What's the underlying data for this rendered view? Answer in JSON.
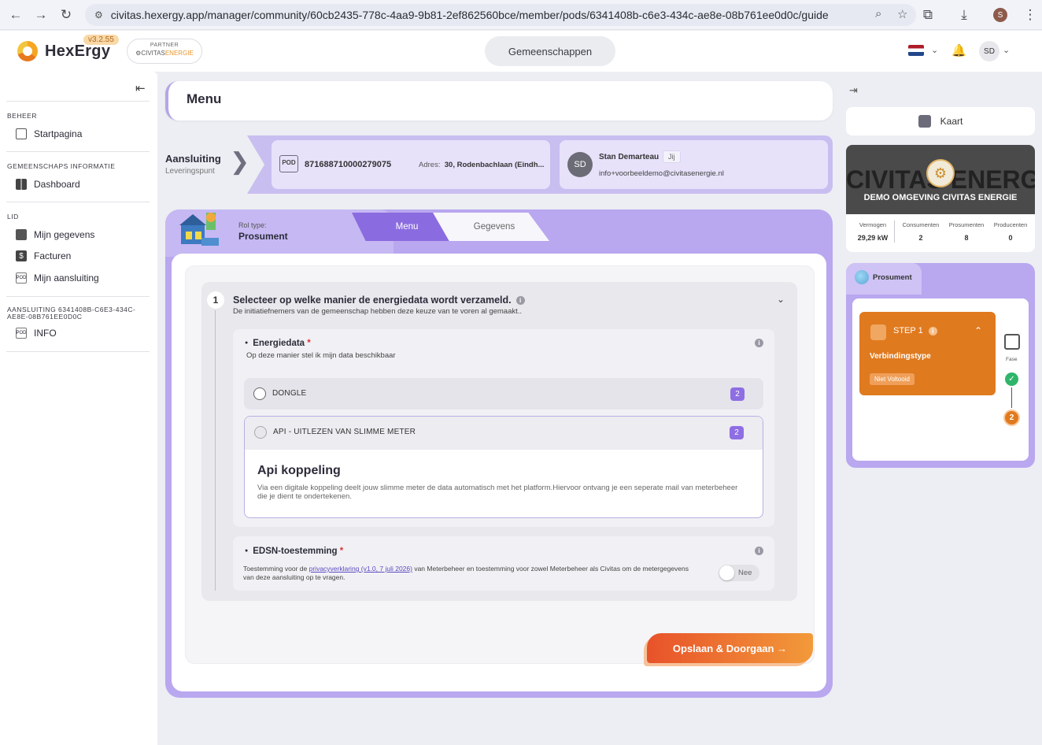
{
  "browser": {
    "url": "civitas.hexergy.app/manager/community/60cb2435-778c-4aa9-9b81-2ef862560bce/member/pods/6341408b-c6e3-434c-ae8e-08b761ee0d0c/guide",
    "profile_initial": "S"
  },
  "header": {
    "brand": "HexErgy",
    "version": "v3.2.55",
    "partner_label": "PARTNER",
    "partner_name_a": "CIVITAS",
    "partner_name_b": "ENERGIE",
    "center_button": "Gemeenschappen",
    "user_initials": "SD",
    "accent_color": "#f29a3a"
  },
  "sidebar": {
    "sections": [
      {
        "title": "BEHEER",
        "items": [
          {
            "label": "Startpagina",
            "icon": "home-icon"
          }
        ]
      },
      {
        "title": "GEMEENSCHAPS INFORMATIE",
        "items": [
          {
            "label": "Dashboard",
            "icon": "dashboard-icon"
          }
        ]
      },
      {
        "title": "LID",
        "items": [
          {
            "label": "Mijn gegevens",
            "icon": "profile-icon"
          },
          {
            "label": "Facturen",
            "icon": "invoice-icon"
          },
          {
            "label": "Mijn aansluiting",
            "icon": "pod-icon"
          }
        ]
      },
      {
        "title": "AANSLUITING 6341408B-C6E3-434C-AE8E-08B761EE0D0C",
        "items": [
          {
            "label": "INFO",
            "icon": "pod-icon"
          }
        ]
      }
    ]
  },
  "main": {
    "menu_title": "Menu",
    "connection": {
      "title": "Aansluiting",
      "subtitle": "Leveringspunt",
      "pod_badge": "POD",
      "pod_number": "871688710000279075",
      "address_label": "Adres:",
      "address_value": "30, Rodenbachlaan (Eindh...",
      "user_initials": "SD",
      "user_name": "Stan Demarteau",
      "user_tag": "Jij",
      "user_email": "info+voorbeeldemo@civitasenergie.nl"
    },
    "role": {
      "label": "Rol type:",
      "value": "Prosument",
      "tabs": [
        {
          "label": "Menu",
          "active": true
        },
        {
          "label": "Gegevens",
          "active": false
        }
      ]
    },
    "step": {
      "number": "1",
      "title": "Selecteer op welke manier de energiedata wordt verzameld.",
      "subtitle": "De initiatiefnemers van de gemeenschap hebben deze keuze van te voren al gemaakt..",
      "energiedata": {
        "title": "Energiedata",
        "required_mark": "*",
        "subtitle": "Op deze manier stel ik mijn data beschikbaar",
        "options": [
          {
            "label": "DONGLE",
            "badge": "2"
          },
          {
            "label": "API - UITLEZEN VAN SLIMME METER",
            "badge": "2",
            "detail_title": "Api koppeling",
            "detail_text": "Via een digitale koppeling deelt jouw slimme meter de data automatisch met het platform.Hiervoor ontvang je een seperate mail van meterbeheer die je dient te ondertekenen."
          }
        ]
      },
      "edsn": {
        "title": "EDSN-toestemming",
        "required_mark": "*",
        "text_before": "Toestemming voor de ",
        "link": "privacyverklaring (v1.0, 7 juli 2026)",
        "text_after": " van Meterbeheer en toestemming voor zowel Meterbeheer als Civitas om de metergegevens van deze aansluiting op te vragen.",
        "toggle_label": "Nee"
      }
    },
    "save_button": "Opslaan & Doorgaan →"
  },
  "right": {
    "map_button": "Kaart",
    "community": {
      "banner_text": "CIVITAS ENERGIE",
      "title": "DEMO OMGEVING CIVITAS ENERGIE",
      "stats": [
        {
          "label": "Vermogen",
          "value": "29,29 kW"
        },
        {
          "label": "Consumenten",
          "value": "2"
        },
        {
          "label": "Prosumenten",
          "value": "8"
        },
        {
          "label": "Producenten",
          "value": "0"
        }
      ]
    },
    "progress": {
      "role_tab": "Prosument",
      "step_label": "STEP 1",
      "step_title": "Verbindingstype",
      "step_status": "Niet Voltooid",
      "fase_label": "Fase",
      "fase_current": "2",
      "step_color": "#e07a1f"
    }
  }
}
